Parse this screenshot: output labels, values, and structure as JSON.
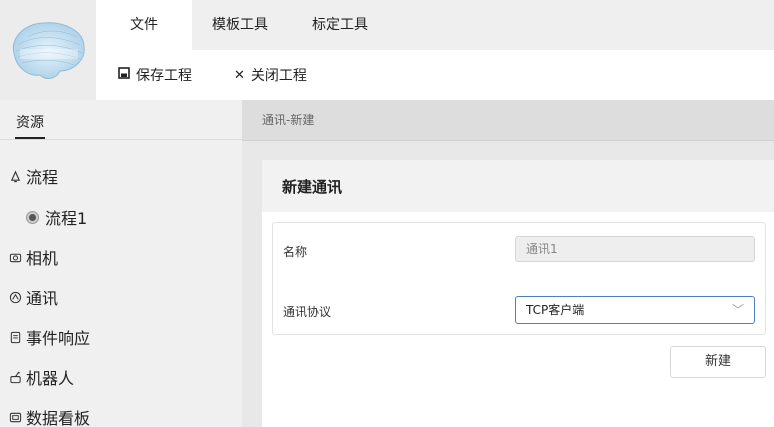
{
  "menu": {
    "tabs": [
      {
        "label": "文件"
      },
      {
        "label": "模板工具"
      },
      {
        "label": "标定工具"
      }
    ]
  },
  "toolbar": {
    "save_label": "保存工程",
    "close_label": "关闭工程"
  },
  "sidebar": {
    "tab_label": "资源",
    "items": [
      {
        "label": "流程",
        "icon": "bell-icon"
      },
      {
        "label": "流程1",
        "icon": "radio-dot-icon"
      },
      {
        "label": "相机",
        "icon": "camera-icon"
      },
      {
        "label": "通讯",
        "icon": "network-icon"
      },
      {
        "label": "事件响应",
        "icon": "document-icon"
      },
      {
        "label": "机器人",
        "icon": "robot-icon"
      },
      {
        "label": "数据看板",
        "icon": "board-icon"
      }
    ]
  },
  "main": {
    "breadcrumb": "通讯-新建",
    "card_title": "新建通讯",
    "form": {
      "name_label": "名称",
      "name_value": "通讯1",
      "protocol_label": "通讯协议",
      "protocol_value": "TCP客户端"
    },
    "create_button": "新建"
  },
  "colors": {
    "accent": "#4a7fc1",
    "sidebar_bg": "#f0f0f0",
    "header_bg": "#efefef"
  }
}
